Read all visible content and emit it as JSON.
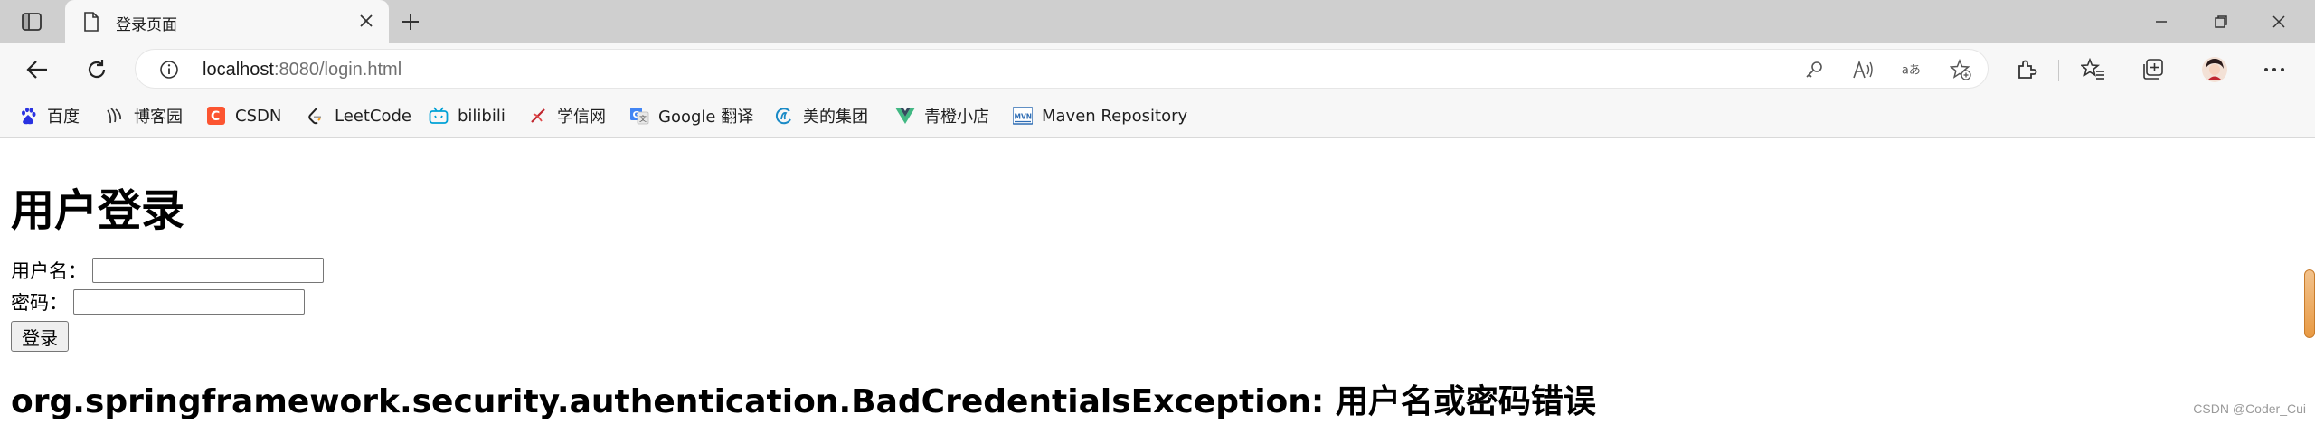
{
  "browser": {
    "tab": {
      "title": "登录页面"
    },
    "address": {
      "host": "localhost",
      "rest": ":8080/login.html"
    },
    "favorites": [
      {
        "label": "百度",
        "icon": "baidu-icon"
      },
      {
        "label": "博客园",
        "icon": "cnblogs-icon"
      },
      {
        "label": "CSDN",
        "icon": "csdn-icon"
      },
      {
        "label": "LeetCode",
        "icon": "leetcode-icon"
      },
      {
        "label": "bilibili",
        "icon": "bilibili-icon"
      },
      {
        "label": "学信网",
        "icon": "chsi-icon"
      },
      {
        "label": "Google 翻译",
        "icon": "google-translate-icon"
      },
      {
        "label": "美的集团",
        "icon": "midea-icon"
      },
      {
        "label": "青橙小店",
        "icon": "vue-icon"
      },
      {
        "label": "Maven Repository",
        "icon": "maven-icon"
      }
    ]
  },
  "page": {
    "title": "用户登录",
    "username_label": "用户名：",
    "username_value": "",
    "password_label": "密码：",
    "password_value": "",
    "login_button": "登录",
    "error_message": "org.springframework.security.authentication.BadCredentialsException: 用户名或密码错误"
  },
  "watermark": "CSDN @Coder_Cui",
  "colors": {
    "tabstrip": "#cfcfcf",
    "toolbar": "#f7f7f7",
    "csdn": "#fc5531",
    "baidu": "#2932e1",
    "bilibili": "#00a1d6",
    "vue": "#41b883"
  }
}
